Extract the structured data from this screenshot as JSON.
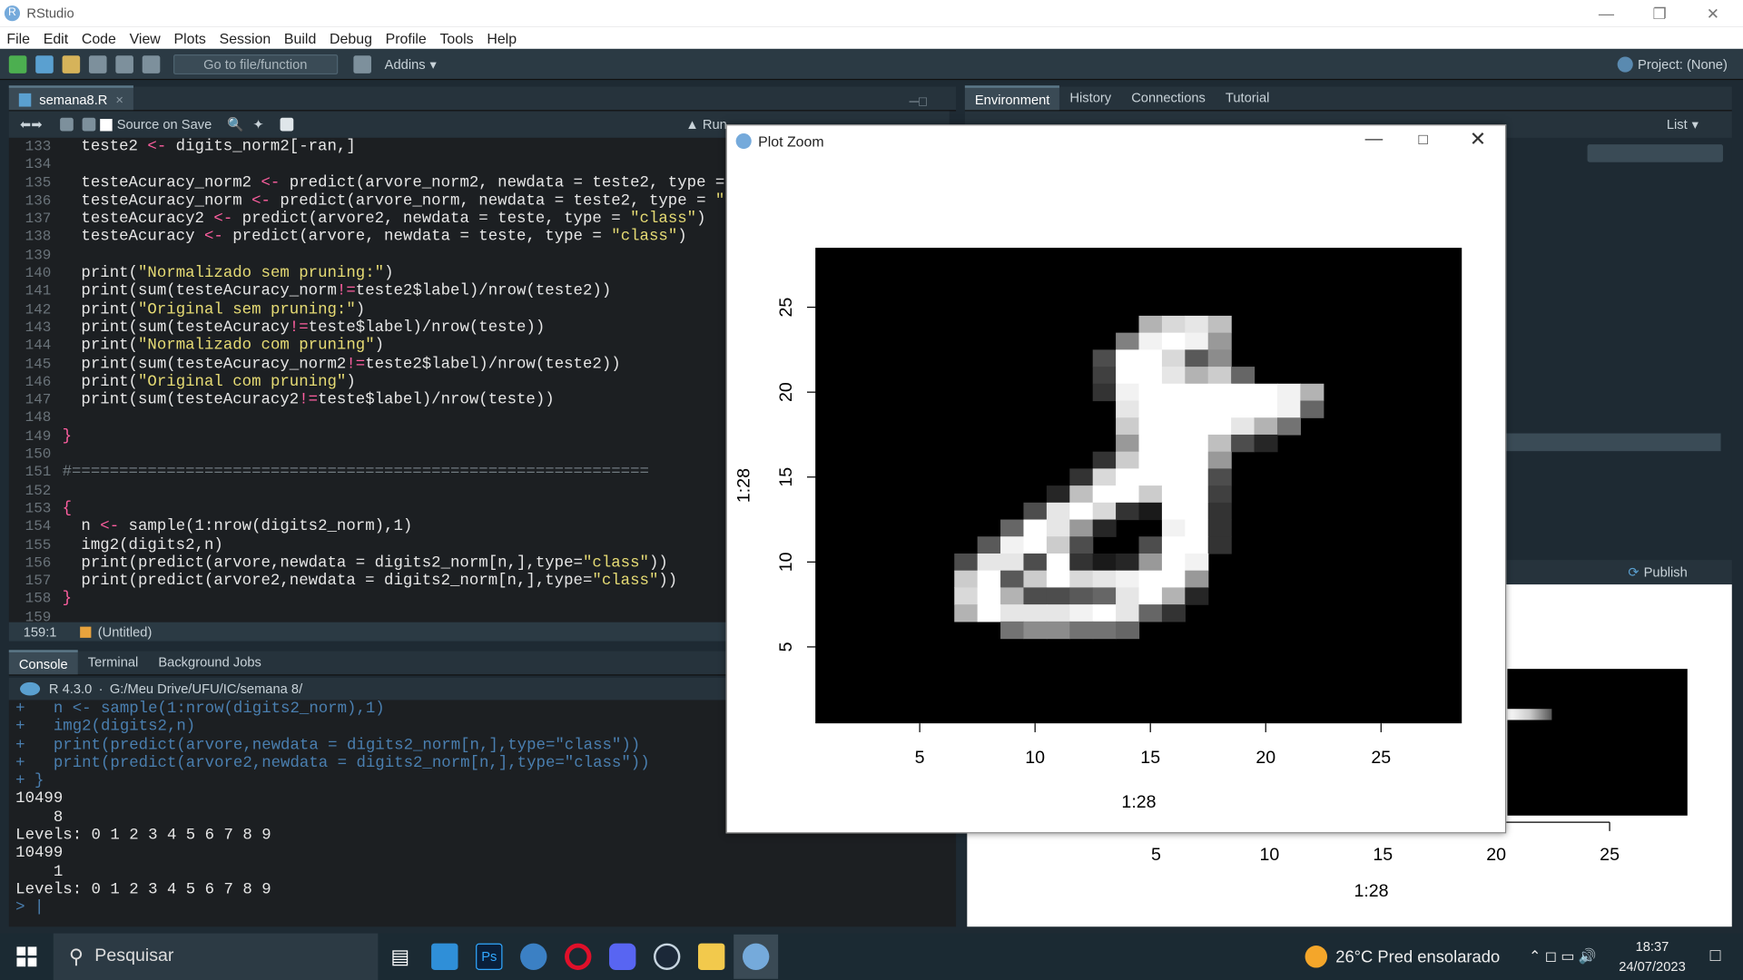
{
  "window": {
    "title": "RStudio",
    "logo": "R"
  },
  "menu": [
    "File",
    "Edit",
    "Code",
    "View",
    "Plots",
    "Session",
    "Build",
    "Debug",
    "Profile",
    "Tools",
    "Help"
  ],
  "toolbar": {
    "goto_placeholder": "Go to file/function",
    "addins": "Addins",
    "project": "Project: (None)"
  },
  "editor": {
    "tab": "semana8.R",
    "source_on_save": "Source on Save",
    "run": "Run",
    "lines": [
      {
        "n": "133",
        "t": "  teste2 <- digits_norm2[-ran,]"
      },
      {
        "n": "134",
        "t": ""
      },
      {
        "n": "135",
        "t": "  testeAcuracy_norm2 <- predict(arvore_norm2, newdata = teste2, type ="
      },
      {
        "n": "136",
        "t": "  testeAcuracy_norm <- predict(arvore_norm, newdata = teste2, type = \"c"
      },
      {
        "n": "137",
        "t": "  testeAcuracy2 <- predict(arvore2, newdata = teste, type = \"class\")"
      },
      {
        "n": "138",
        "t": "  testeAcuracy <- predict(arvore, newdata = teste, type = \"class\")"
      },
      {
        "n": "139",
        "t": ""
      },
      {
        "n": "140",
        "t": "  print(\"Normalizado sem pruning:\")"
      },
      {
        "n": "141",
        "t": "  print(sum(testeAcuracy_norm!=teste2$label)/nrow(teste2))"
      },
      {
        "n": "142",
        "t": "  print(\"Original sem pruning:\")"
      },
      {
        "n": "143",
        "t": "  print(sum(testeAcuracy!=teste$label)/nrow(teste))"
      },
      {
        "n": "144",
        "t": "  print(\"Normalizado com pruning\")"
      },
      {
        "n": "145",
        "t": "  print(sum(testeAcuracy_norm2!=teste2$label)/nrow(teste2))"
      },
      {
        "n": "146",
        "t": "  print(\"Original com pruning\")"
      },
      {
        "n": "147",
        "t": "  print(sum(testeAcuracy2!=teste$label)/nrow(teste))"
      },
      {
        "n": "148",
        "t": ""
      },
      {
        "n": "149",
        "t": "}"
      },
      {
        "n": "150",
        "t": ""
      },
      {
        "n": "151",
        "t": "#============================================================="
      },
      {
        "n": "152",
        "t": ""
      },
      {
        "n": "153",
        "t": "{"
      },
      {
        "n": "154",
        "t": "  n <- sample(1:nrow(digits2_norm),1)"
      },
      {
        "n": "155",
        "t": "  img2(digits2,n)"
      },
      {
        "n": "156",
        "t": "  print(predict(arvore,newdata = digits2_norm[n,],type=\"class\"))"
      },
      {
        "n": "157",
        "t": "  print(predict(arvore2,newdata = digits2_norm[n,],type=\"class\"))"
      },
      {
        "n": "158",
        "t": "}"
      },
      {
        "n": "159",
        "t": ""
      }
    ],
    "status_pos": "159:1",
    "status_scope": "(Untitled)"
  },
  "console": {
    "tabs": [
      "Console",
      "Terminal",
      "Background Jobs"
    ],
    "r_version": "R 4.3.0",
    "path": "G:/Meu Drive/UFU/IC/semana 8/",
    "lines": [
      {
        "c": "in",
        "t": "+   n <- sample(1:nrow(digits2_norm),1)"
      },
      {
        "c": "in",
        "t": "+   img2(digits2,n)"
      },
      {
        "c": "in",
        "t": "+   print(predict(arvore,newdata = digits2_norm[n,],type=\"class\"))"
      },
      {
        "c": "in",
        "t": "+   print(predict(arvore2,newdata = digits2_norm[n,],type=\"class\"))"
      },
      {
        "c": "in",
        "t": "+ }"
      },
      {
        "c": "out",
        "t": "10499"
      },
      {
        "c": "out",
        "t": "    8"
      },
      {
        "c": "out",
        "t": "Levels: 0 1 2 3 4 5 6 7 8 9"
      },
      {
        "c": "out",
        "t": "10499"
      },
      {
        "c": "out",
        "t": "    1"
      },
      {
        "c": "out",
        "t": "Levels: 0 1 2 3 4 5 6 7 8 9"
      },
      {
        "c": "in",
        "t": "> |"
      }
    ]
  },
  "env": {
    "tabs": [
      "Environment",
      "History",
      "Connections",
      "Tutorial"
    ],
    "list": "List"
  },
  "plots": {
    "publish": "Publish",
    "xticks": [
      "5",
      "10",
      "15",
      "20",
      "25"
    ],
    "xlabel": "1:28"
  },
  "plot_zoom": {
    "title": "Plot Zoom",
    "xticks": [
      "5",
      "10",
      "15",
      "20",
      "25"
    ],
    "yticks": [
      "5",
      "10",
      "15",
      "20",
      "25"
    ],
    "xlabel": "1:28",
    "ylabel": "1:28"
  },
  "taskbar": {
    "search": "Pesquisar",
    "weather": "26°C  Pred ensolarado",
    "time": "18:37",
    "date": "24/07/2023"
  }
}
